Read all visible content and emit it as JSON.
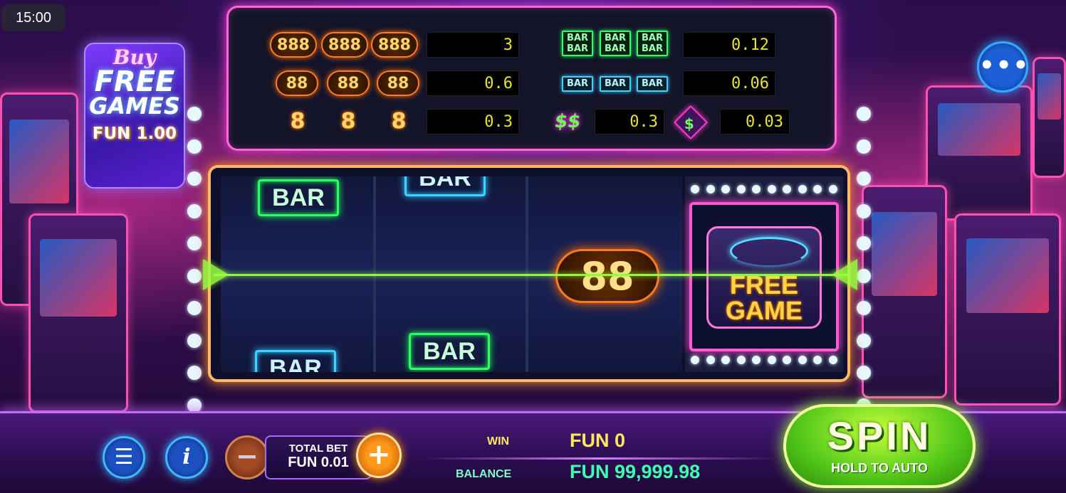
{
  "status": {
    "time": "15:00"
  },
  "buy_free_games": {
    "line1": "Buy",
    "line2": "FREE",
    "line3": "GAMES",
    "price": "FUN 1.00"
  },
  "menu": {
    "dots": "•••"
  },
  "paytable": {
    "left": [
      {
        "symbol": "888",
        "payout": "3"
      },
      {
        "symbol": "88",
        "payout": "0.6"
      },
      {
        "symbol": "8",
        "payout": "0.3"
      }
    ],
    "right": [
      {
        "symbol": "BAR BAR",
        "payout": "0.12"
      },
      {
        "symbol": "BAR",
        "payout": "0.06"
      }
    ],
    "dollar": {
      "symbol": "$$",
      "payout": "0.3"
    },
    "diamond": {
      "symbol": "$",
      "payout": "0.03"
    },
    "sym_labels": {
      "s888": "888",
      "s88": "88",
      "s8": "8",
      "bar": "BAR"
    }
  },
  "reels": {
    "reel1": {
      "top": "BAR",
      "bottom": "BAR"
    },
    "reel2": {
      "top": "BAR",
      "bottom": "BAR"
    },
    "reel3": {
      "middle": "88"
    },
    "bonus": {
      "line1": "FREE",
      "line2": "GAME"
    }
  },
  "controls": {
    "menu_icon": "☰",
    "info_icon": "i",
    "minus": "−",
    "plus": "+",
    "total_bet_label": "TOTAL BET",
    "total_bet_value": "FUN 0.01",
    "win_label": "WIN",
    "win_value": "FUN 0",
    "balance_label": "BALANCE",
    "balance_value": "FUN 99,999.98",
    "spin_label": "SPIN",
    "spin_sub": "HOLD TO AUTO"
  },
  "colors": {
    "win_value": "#ffe85a",
    "balance_value": "#3fffb0",
    "spin_green": "#53c81a",
    "payout_text": "#e8e62a"
  }
}
